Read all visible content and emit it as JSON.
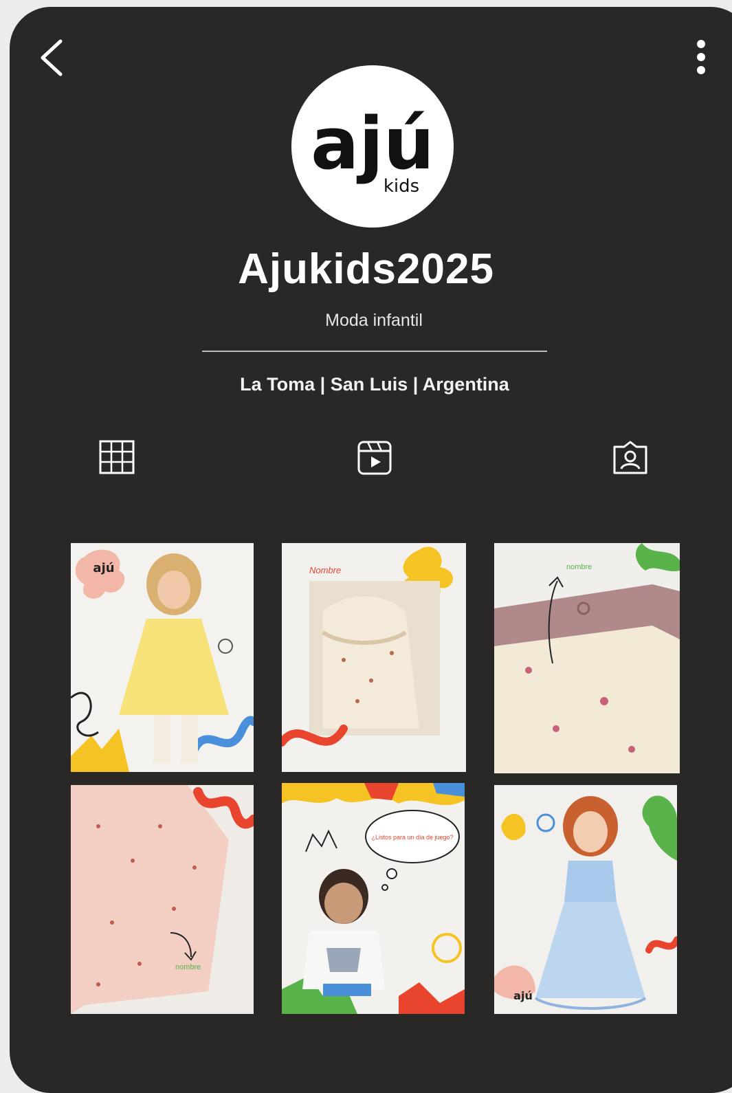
{
  "profile": {
    "logo_text": "ajú",
    "logo_sub": "kids",
    "username": "Ajukids2025",
    "tagline": "Moda infantil",
    "location": "La Toma | San Luis | Argentina"
  },
  "nav": {
    "back_icon": "chevron-left-icon",
    "more_icon": "more-vertical-icon"
  },
  "tabs": [
    {
      "name": "posts",
      "icon": "grid-icon"
    },
    {
      "name": "reels",
      "icon": "reels-icon"
    },
    {
      "name": "tagged",
      "icon": "tagged-user-icon"
    }
  ],
  "posts": [
    {
      "logo": "ajú"
    },
    {
      "label": "Nombre"
    },
    {
      "label": "nombre"
    },
    {
      "label": "nombre"
    },
    {
      "bubble": "¿Listos para un día de juego?"
    },
    {
      "logo": "ajú"
    }
  ],
  "colors": {
    "background": "#2a2827",
    "text": "#ffffff",
    "accent_red": "#e8442e",
    "accent_yellow": "#f6c324",
    "accent_green": "#59b34a",
    "accent_blue": "#4a8fd9"
  }
}
